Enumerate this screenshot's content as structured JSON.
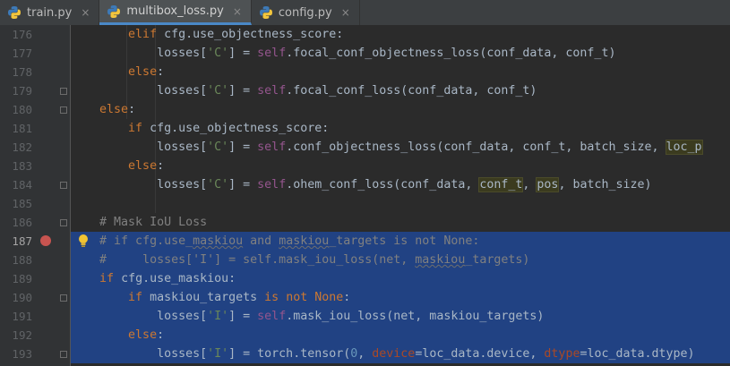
{
  "tabs": [
    {
      "label": "train.py",
      "icon": "python-file-icon",
      "active": false
    },
    {
      "label": "multibox_loss.py",
      "icon": "python-file-icon",
      "active": true
    },
    {
      "label": "config.py",
      "icon": "python-file-icon",
      "active": false
    }
  ],
  "close_glyph": "×",
  "colors": {
    "editor_bg": "#2b2b2b",
    "gutter_bg": "#313335",
    "selection": "#214283",
    "keyword": "#cc7832",
    "self": "#94558d",
    "string": "#6a8759",
    "number": "#6897bb",
    "kwarg": "#aa4926",
    "comment": "#808080",
    "breakpoint": "#c75450"
  },
  "breakpoint_line": "187",
  "code": [
    {
      "n": "176",
      "tokens": [
        [
          "",
          "        "
        ],
        [
          "kw",
          "elif "
        ],
        [
          "",
          "cfg.use_objectness_score:"
        ]
      ]
    },
    {
      "n": "177",
      "tokens": [
        [
          "",
          "            losses["
        ],
        [
          "str",
          "'C'"
        ],
        [
          "",
          "] = "
        ],
        [
          "self",
          "self"
        ],
        [
          "",
          ".focal_conf_objectness_loss(conf_data, conf_t)"
        ]
      ]
    },
    {
      "n": "178",
      "tokens": [
        [
          "",
          "        "
        ],
        [
          "kw",
          "else"
        ],
        [
          "",
          ":"
        ]
      ]
    },
    {
      "n": "179",
      "tokens": [
        [
          "",
          "            losses["
        ],
        [
          "str",
          "'C'"
        ],
        [
          "",
          "] = "
        ],
        [
          "self",
          "self"
        ],
        [
          "",
          ".focal_conf_loss(conf_data, conf_t)"
        ]
      ]
    },
    {
      "n": "180",
      "tokens": [
        [
          "",
          "    "
        ],
        [
          "kw",
          "else"
        ],
        [
          "",
          ":"
        ]
      ]
    },
    {
      "n": "181",
      "tokens": [
        [
          "",
          "        "
        ],
        [
          "kw",
          "if "
        ],
        [
          "",
          "cfg.use_objectness_score:"
        ]
      ]
    },
    {
      "n": "182",
      "tokens": [
        [
          "",
          "            losses["
        ],
        [
          "str",
          "'C'"
        ],
        [
          "",
          "] = "
        ],
        [
          "self",
          "self"
        ],
        [
          "",
          ".conf_objectness_loss(conf_data, conf_t, batch_size, "
        ],
        [
          "hl",
          "loc_p"
        ]
      ]
    },
    {
      "n": "183",
      "tokens": [
        [
          "",
          "        "
        ],
        [
          "kw",
          "else"
        ],
        [
          "",
          ":"
        ]
      ]
    },
    {
      "n": "184",
      "tokens": [
        [
          "",
          "            losses["
        ],
        [
          "str",
          "'C'"
        ],
        [
          "",
          "] = "
        ],
        [
          "self",
          "self"
        ],
        [
          "",
          ".ohem_conf_loss(conf_data, "
        ],
        [
          "hl",
          "conf_t"
        ],
        [
          "",
          ", "
        ],
        [
          "hl",
          "pos"
        ],
        [
          "",
          ", batch_size)"
        ]
      ]
    },
    {
      "n": "185",
      "tokens": []
    },
    {
      "n": "186",
      "tokens": [
        [
          "",
          "    "
        ],
        [
          "cmt",
          "# Mask IoU Loss"
        ]
      ]
    },
    {
      "n": "187",
      "tokens": [
        [
          "",
          "    "
        ],
        [
          "cmt",
          "# if cfg.use_"
        ],
        [
          "cmtsq",
          "maskiou"
        ],
        [
          "cmt",
          " and "
        ],
        [
          "cmtsq",
          "maskiou"
        ],
        [
          "cmt",
          "_targets is not None:"
        ]
      ]
    },
    {
      "n": "188",
      "tokens": [
        [
          "",
          "    "
        ],
        [
          "cmt",
          "#     losses['I'] = self.mask_iou_loss(net, "
        ],
        [
          "cmtsq",
          "maskiou"
        ],
        [
          "cmt",
          "_targets)"
        ]
      ]
    },
    {
      "n": "189",
      "tokens": [
        [
          "",
          "    "
        ],
        [
          "kw",
          "if "
        ],
        [
          "",
          "cfg.use_maskiou:"
        ]
      ]
    },
    {
      "n": "190",
      "tokens": [
        [
          "",
          "        "
        ],
        [
          "kw",
          "if "
        ],
        [
          "",
          "maskiou_targets "
        ],
        [
          "kw",
          "is not None"
        ],
        [
          "",
          ":"
        ]
      ]
    },
    {
      "n": "191",
      "tokens": [
        [
          "",
          "            losses["
        ],
        [
          "str",
          "'I'"
        ],
        [
          "",
          "] = "
        ],
        [
          "self",
          "self"
        ],
        [
          "",
          ".mask_iou_loss(net, maskiou_targets)"
        ]
      ]
    },
    {
      "n": "192",
      "tokens": [
        [
          "",
          "        "
        ],
        [
          "kw",
          "else"
        ],
        [
          "",
          ":"
        ]
      ]
    },
    {
      "n": "193",
      "tokens": [
        [
          "",
          "            losses["
        ],
        [
          "str",
          "'I'"
        ],
        [
          "",
          "] = torch.tensor("
        ],
        [
          "num",
          "0"
        ],
        [
          "",
          ", "
        ],
        [
          "kwarg",
          "device"
        ],
        [
          "",
          "=loc_data.device, "
        ],
        [
          "kwarg",
          "dtype"
        ],
        [
          "",
          "=loc_data.dtype)"
        ]
      ]
    }
  ]
}
